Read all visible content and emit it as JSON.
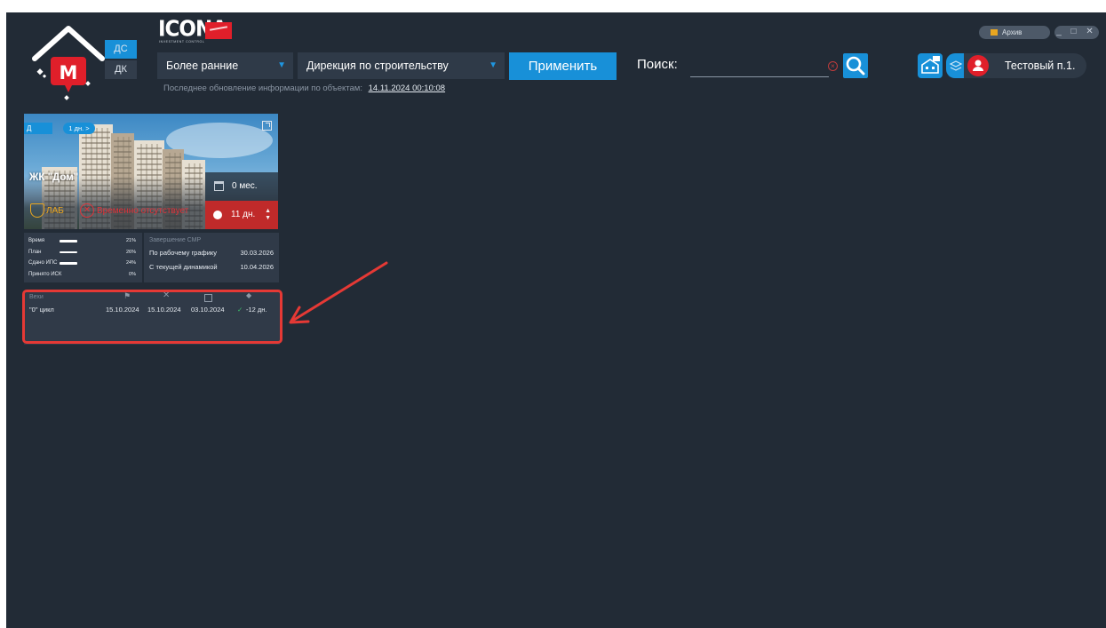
{
  "header": {
    "mode_ds": "ДС",
    "mode_dk": "ДК",
    "brand": "ICONA",
    "brand_sub": "INVESTMENT CONTROL",
    "period_select": "Более ранние",
    "direction_select": "Дирекция по строительству",
    "apply_label": "Применить",
    "update_text": "Последнее обновление информации по объектам:",
    "update_date": "14.11.2024 00:10:08",
    "search_label": "Поиск:",
    "search_value": "",
    "user_name": "Тестовый п.1.",
    "archive_label": "Архив",
    "window_controls": "_ □ ✕"
  },
  "card": {
    "tag_d": "Д",
    "tag_days": "1 дн. >",
    "name": "ЖК \"Дом\"",
    "months": "0 мес.",
    "days": "11 дн.",
    "lab": "ЛАБ",
    "absent": "Временно отсутствует",
    "stats": [
      {
        "label": "Время",
        "pct": "21%"
      },
      {
        "label": "План",
        "pct": "26%"
      },
      {
        "label": "Сдано ИПС",
        "pct": "24%"
      },
      {
        "label": "Принято ИСК",
        "pct": "0%"
      }
    ],
    "smp_title": "Завершение СМР",
    "smp_rows": [
      {
        "label": "По рабочему графику",
        "value": "30.03.2026"
      },
      {
        "label": "С текущей динамикой",
        "value": "10.04.2026"
      }
    ],
    "stages_header": "Вехи",
    "stage": {
      "name": "\"0\" цикл",
      "d1": "15.10.2024",
      "d2": "15.10.2024",
      "d3": "03.10.2024",
      "delta": "-12 дн."
    }
  },
  "colors": {
    "background": "#222b36",
    "panel": "#303a48",
    "accent": "#1890d8",
    "danger": "#e01f2a",
    "warning": "#e9a620",
    "ok": "#3cc26b"
  }
}
